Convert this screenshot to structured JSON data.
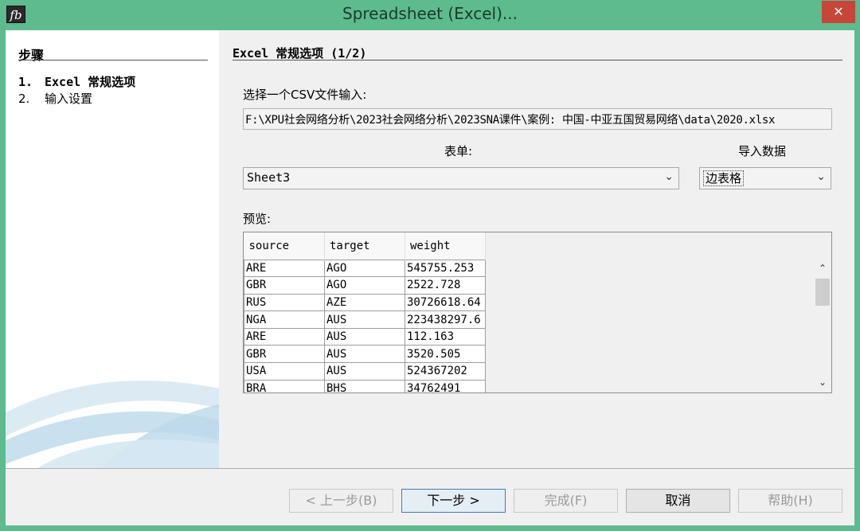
{
  "window": {
    "title": "Spreadsheet (Excel)...",
    "app_icon_glyph": "fb",
    "close_glyph": "✕"
  },
  "steps": {
    "title": "步骤",
    "items": [
      {
        "num": "1.",
        "label": "Excel 常规选项",
        "active": true
      },
      {
        "num": "2.",
        "label": "输入设置",
        "active": false
      }
    ]
  },
  "main": {
    "title": "Excel 常规选项 (1/2)",
    "csv_label": "选择一个CSV文件输入:",
    "file_path": "F:\\XPU社会网络分析\\2023社会网络分析\\2023SNA课件\\案例: 中国-中亚五国贸易网络\\data\\2020.xlsx",
    "sheet_label": "表单:",
    "sheet_value": "Sheet3",
    "import_label": "导入数据",
    "import_value": "边表格",
    "preview_label": "预览:"
  },
  "preview": {
    "columns": [
      "source",
      "target",
      "weight"
    ],
    "rows": [
      [
        "ARE",
        "AGO",
        "545755.253"
      ],
      [
        "GBR",
        "AGO",
        "2522.728"
      ],
      [
        "RUS",
        "AZE",
        "30726618.64"
      ],
      [
        "NGA",
        "AUS",
        "223438297.6"
      ],
      [
        "ARE",
        "AUS",
        "112.163"
      ],
      [
        "GBR",
        "AUS",
        "3520.505"
      ],
      [
        "USA",
        "AUS",
        "524367202"
      ],
      [
        "BRA",
        "BHS",
        "34762491"
      ]
    ]
  },
  "buttons": {
    "back": "< 上一步(B)",
    "next": "下一步 >",
    "finish": "完成(F)",
    "cancel": "取消",
    "help": "帮助(H)"
  },
  "icons": {
    "combo_arrow": "chevron-down-icon",
    "scroll_up": "chevron-up-icon",
    "scroll_down": "chevron-down-icon"
  },
  "colors": {
    "title_bar": "#5dbb8e",
    "close_button": "#c7463a",
    "dialog_bg": "#f0f0f0"
  }
}
